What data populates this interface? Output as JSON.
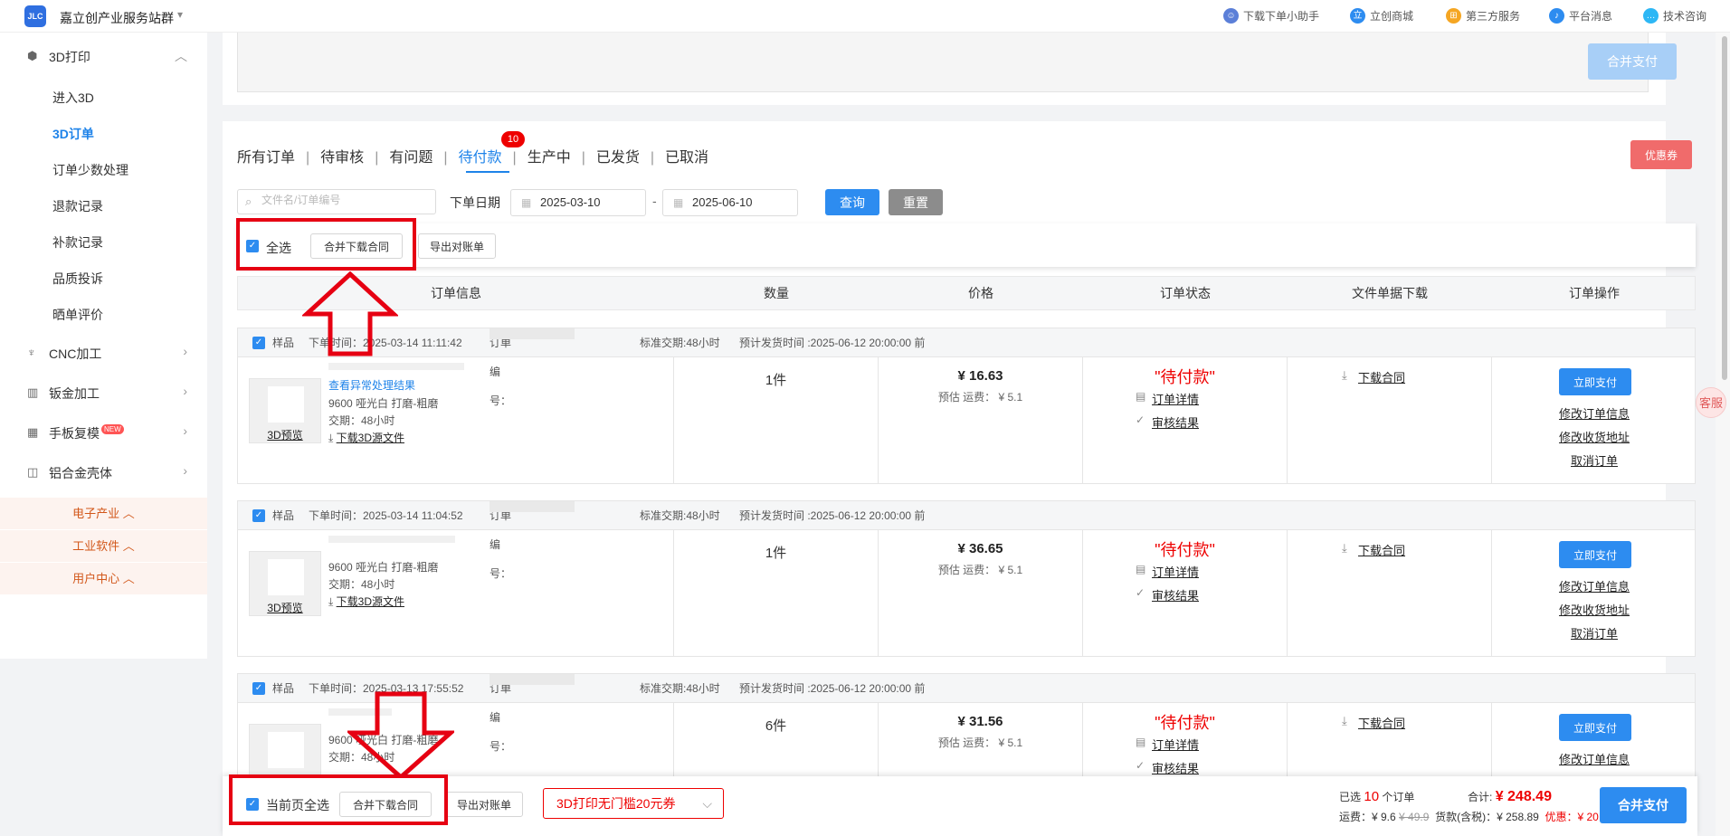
{
  "header": {
    "logo_text": "JLC",
    "site_name": "嘉立创产业服务站群",
    "nav": [
      {
        "label": "下载下单小助手",
        "icon": "assistant-icon",
        "color": "#5b7fd8"
      },
      {
        "label": "立创商城",
        "icon": "mall-icon",
        "color": "#2d8cf0"
      },
      {
        "label": "第三方服务",
        "icon": "service-icon",
        "color": "#f5a623"
      },
      {
        "label": "平台消息",
        "icon": "bell-icon",
        "color": "#2d8cf0"
      },
      {
        "label": "技术咨询",
        "icon": "chat-icon",
        "color": "#2db7f5"
      }
    ]
  },
  "sidebar": {
    "group_3d": {
      "label": "3D打印",
      "icon": "3d-print-icon"
    },
    "subitems": [
      "进入3D",
      "3D订单",
      "订单少数处理",
      "退款记录",
      "补款记录",
      "品质投诉",
      "晒单评价"
    ],
    "active_index": 1,
    "groups": [
      {
        "label": "CNC加工",
        "icon": "cnc-icon"
      },
      {
        "label": "钣金加工",
        "icon": "sheet-metal-icon"
      },
      {
        "label": "手板复模",
        "icon": "prototype-icon",
        "badge": "NEW"
      },
      {
        "label": "铝合金壳体",
        "icon": "aluminum-case-icon"
      }
    ],
    "footer": [
      "电子产业",
      "工业软件",
      "用户中心"
    ]
  },
  "top_panel": {
    "pay_all_label": "合并支付"
  },
  "tabs": [
    {
      "label": "所有订单"
    },
    {
      "label": "待审核"
    },
    {
      "label": "有问题"
    },
    {
      "label": "待付款",
      "badge": "10"
    },
    {
      "label": "生产中"
    },
    {
      "label": "已发货"
    },
    {
      "label": "已取消"
    }
  ],
  "coupon_button": "优惠券",
  "filters": {
    "search_placeholder": "文件名/订单编号",
    "date_label": "下单日期",
    "date_from": "2025-03-10",
    "date_to": "2025-06-10",
    "query": "查询",
    "reset": "重置"
  },
  "batch": {
    "select_all": "全选",
    "merge_download": "合并下载合同",
    "export": "导出对账单"
  },
  "columns": [
    "订单信息",
    "数量",
    "价格",
    "订单状态",
    "文件单据下载",
    "订单操作"
  ],
  "orders": [
    {
      "tag": "样品",
      "time": "下单时间：2025-03-14 11:11:42",
      "order_no_label": "订单编号：",
      "lead": "标准交期:48小时",
      "ship_time": "预计发货时间 :2025-06-12 20:00:00 前",
      "preview": "3D预览",
      "exception_link": "查看异常处理结果",
      "material": "9600  哑光白 打磨-粗磨",
      "delivery": "交期：48小时",
      "download_src": "下载3D源文件",
      "qty": "1件",
      "price": "¥ 16.63",
      "ship_fee": "预估 运费：  ¥ 5.1",
      "status": "\"待付款\"",
      "detail": "订单详情",
      "review": "审核结果",
      "contract": "下载合同",
      "pay": "立即支付",
      "ops": [
        "修改订单信息",
        "修改收货地址",
        "取消订单"
      ]
    },
    {
      "tag": "样品",
      "time": "下单时间：2025-03-14 11:04:52",
      "order_no_label": "订单编号：",
      "lead": "标准交期:48小时",
      "ship_time": "预计发货时间 :2025-06-12 20:00:00 前",
      "preview": "3D预览",
      "material": "9600  哑光白 打磨-粗磨",
      "delivery": "交期：48小时",
      "download_src": "下载3D源文件",
      "qty": "1件",
      "price": "¥ 36.65",
      "ship_fee": "预估 运费：  ¥ 5.1",
      "status": "\"待付款\"",
      "detail": "订单详情",
      "review": "审核结果",
      "contract": "下载合同",
      "pay": "立即支付",
      "ops": [
        "修改订单信息",
        "修改收货地址",
        "取消订单"
      ]
    },
    {
      "tag": "样品",
      "time": "下单时间：2025-03-13 17:55:52",
      "order_no_label": "订单编号：",
      "lead": "标准交期:48小时",
      "ship_time": "预计发货时间 :2025-06-12 20:00:00 前",
      "preview": "3D预览",
      "material": "9600  哑光白 打磨-粗磨",
      "delivery": "交期：48小时",
      "qty": "6件",
      "price": "¥ 31.56",
      "ship_fee": "预估 运费：  ¥ 5.1",
      "status": "\"待付款\"",
      "detail": "订单详情",
      "review": "审核结果",
      "contract": "下载合同",
      "pay": "立即支付",
      "ops": [
        "修改订单信息"
      ]
    }
  ],
  "bottom": {
    "select_page": "当前页全选",
    "merge_download": "合并下载合同",
    "export": "导出对账单",
    "coupon_select": "3D打印无门槛20元券",
    "selected_prefix": "已选",
    "selected_count": "10",
    "selected_suffix": "个订单",
    "ship_label": "运费：¥ 9.6",
    "ship_old": "¥ 49.9",
    "goods_label": "货款(含税)：¥ 258.89",
    "total_label": "合计:",
    "total_value": "¥ 248.49",
    "discount": "优惠：¥ 20",
    "pay_all": "合并支付"
  },
  "float_button": "客服",
  "colors": {
    "primary": "#2d8cf0",
    "danger": "#e00000",
    "annotation": "#e60012"
  }
}
